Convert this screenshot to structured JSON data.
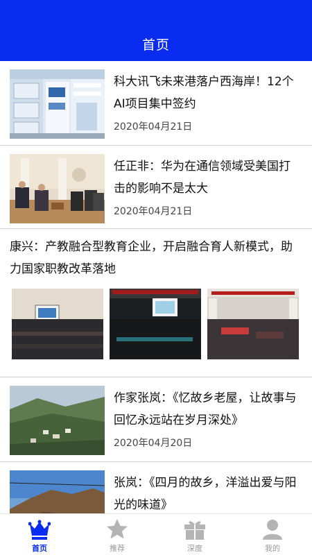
{
  "header": {
    "title": "首页"
  },
  "feed": {
    "items": [
      {
        "headline": "科大讯飞未来港落户西海岸！12个AI项目集中签约",
        "date": "2020年04月21日",
        "image": "photo-exhibition-hall"
      },
      {
        "headline": "任正非：华为在通信领域受美国打击的影响不是太大",
        "date": "2020年04月21日",
        "image": "photo-interview-room"
      },
      {
        "headline": "康兴：产教融合型教育企业，开启融合育人新模式，助力国家职教改革落地",
        "images": [
          "photo-auditorium-1",
          "photo-auditorium-2",
          "photo-auditorium-3"
        ]
      },
      {
        "headline": "作家张岚：《忆故乡老屋，让故事与回忆永远站在岁月深处》",
        "date": "2020年04月20日",
        "image": "photo-mountain-village"
      },
      {
        "headline": "张岚：《四月的故乡，洋溢出爱与阳光的味道》",
        "image": "photo-mountain-landscape"
      }
    ]
  },
  "tabbar": {
    "tabs": [
      {
        "label": "首页",
        "icon": "crown-icon",
        "active": true
      },
      {
        "label": "推荐",
        "icon": "star-icon",
        "active": false
      },
      {
        "label": "深度",
        "icon": "gift-icon",
        "active": false
      },
      {
        "label": "我的",
        "icon": "user-icon",
        "active": false
      }
    ],
    "active_color": "#0a2cf0",
    "inactive_color": "#b4b4b4"
  },
  "colors": {
    "brand": "#0a2cf0",
    "divider": "#cfcfcf"
  }
}
